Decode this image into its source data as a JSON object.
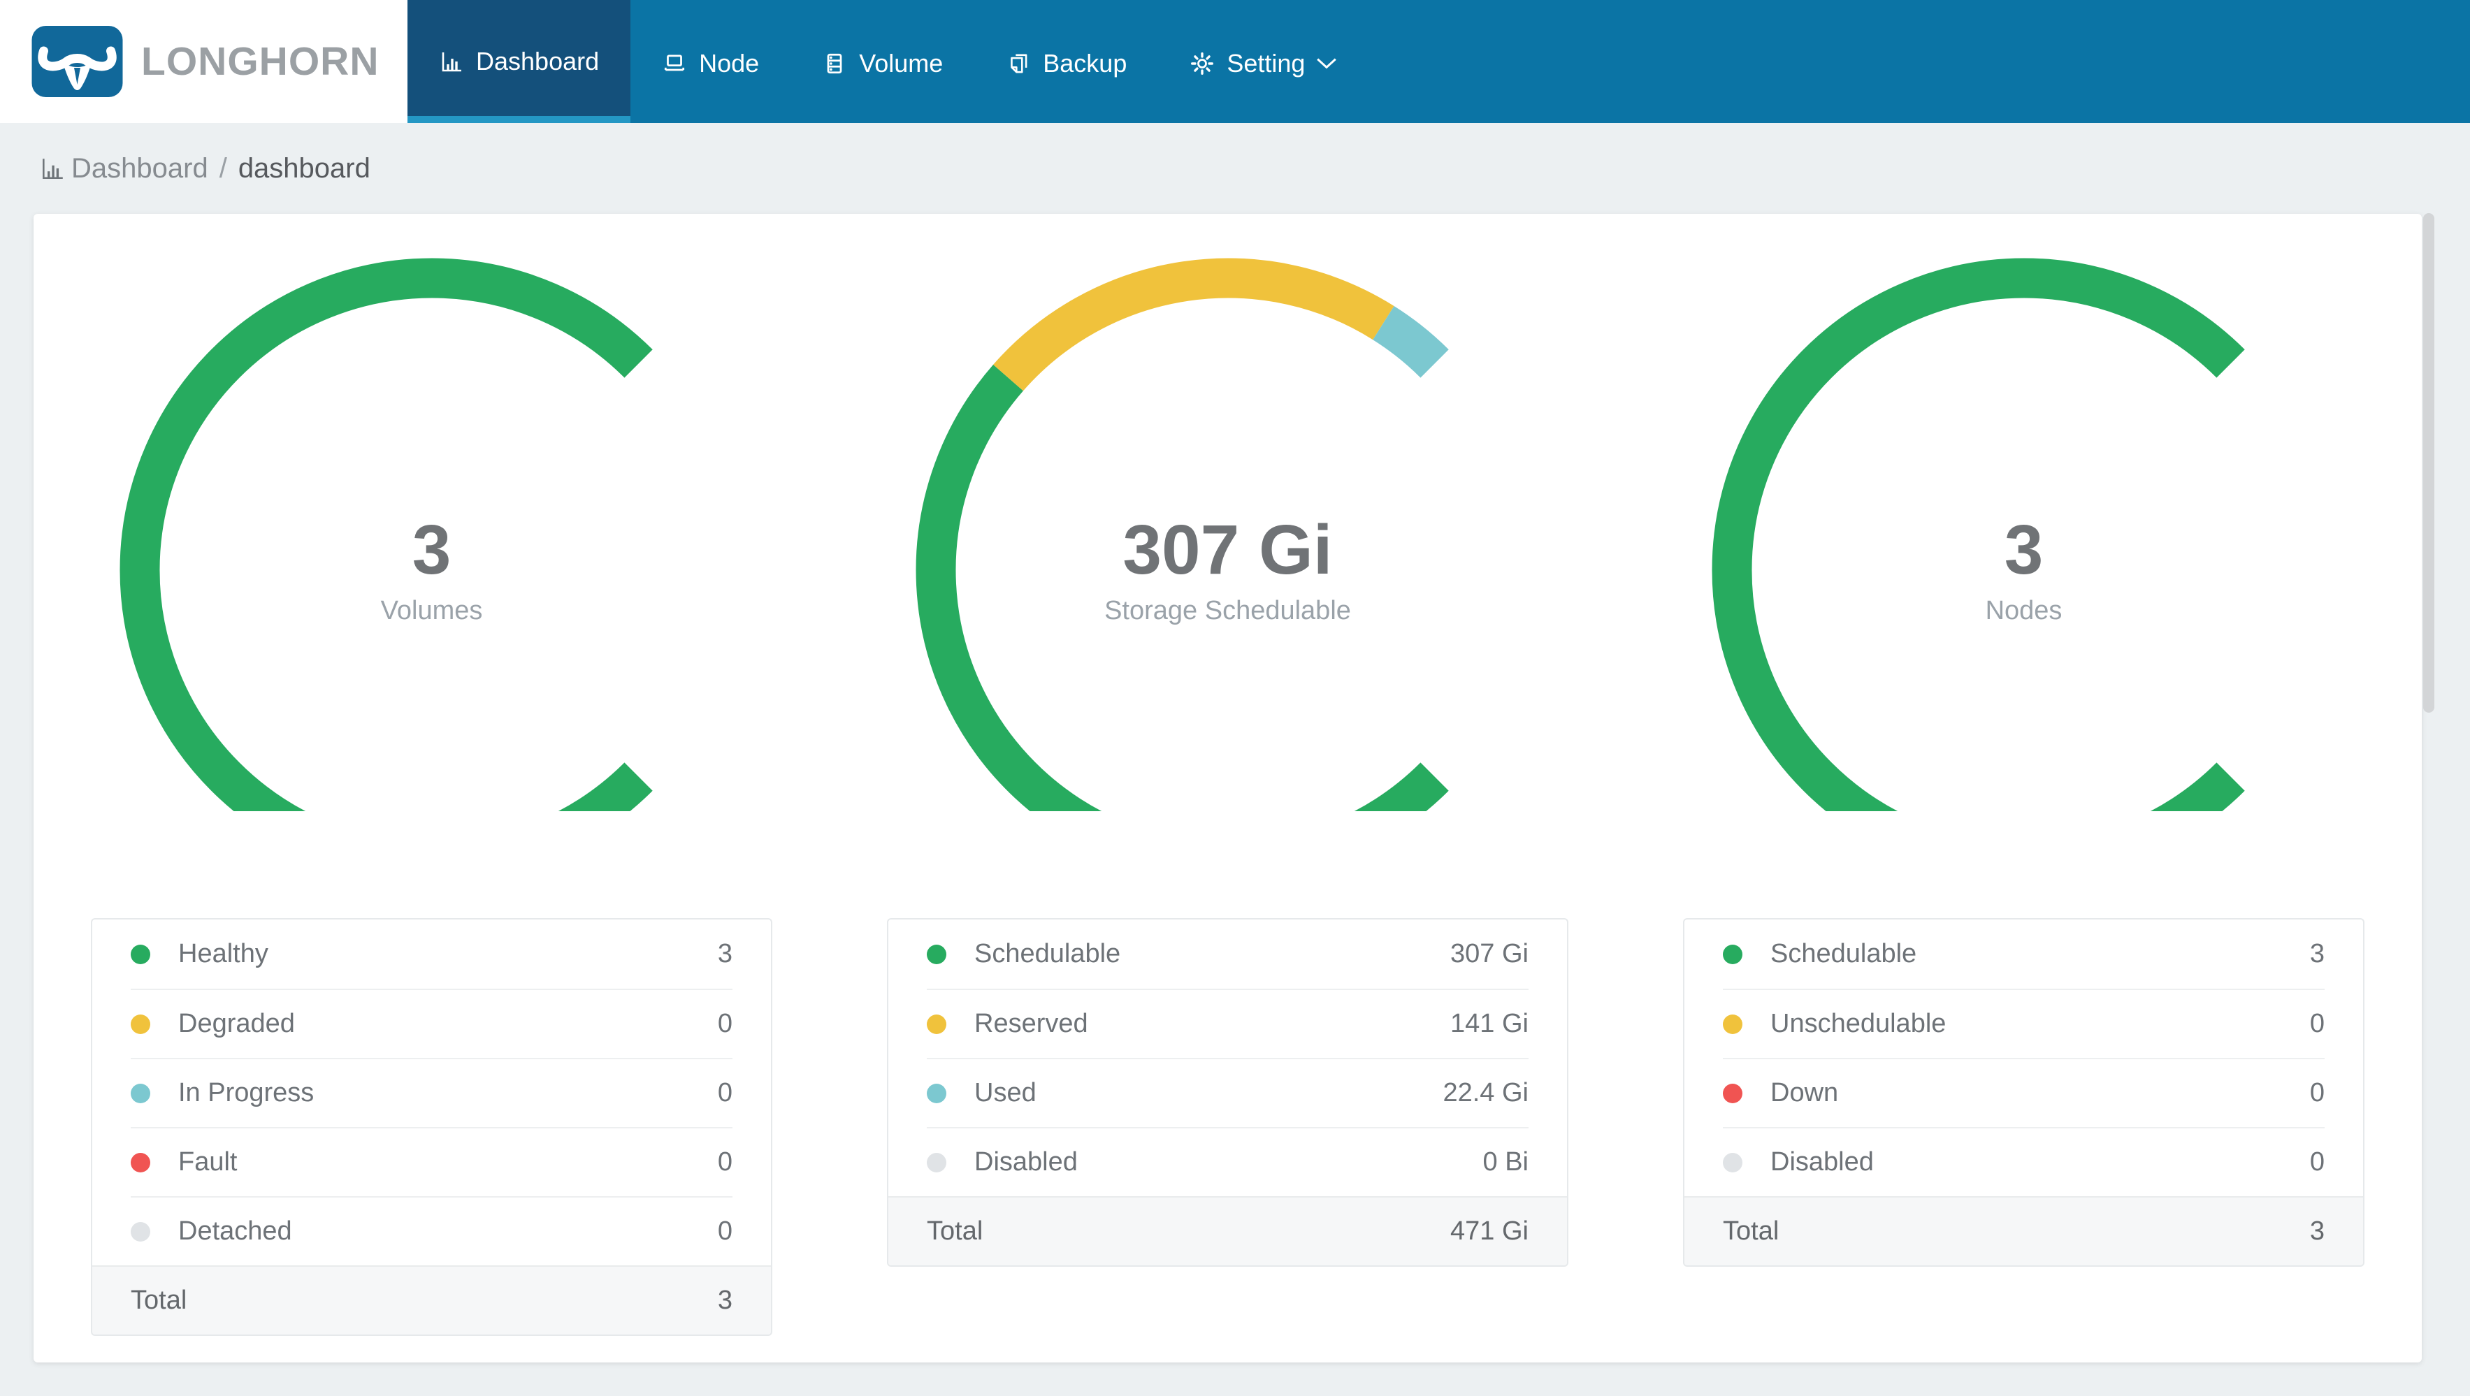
{
  "colors": {
    "nav_bg": "#0b74a5",
    "nav_active_bg": "#14507b",
    "nav_active_underline": "#2497c4",
    "page_bg": "#ecf0f2",
    "logo_bg": "#11689a",
    "brand_text": "#9ba0a4",
    "green": "#27ab5f",
    "yellow": "#f0c23c",
    "teal": "#7cc8d0",
    "red": "#f05452",
    "gray": "#e0e3e6"
  },
  "nav": {
    "brand": "LONGHORN",
    "items": [
      {
        "label": "Dashboard",
        "icon": "bar-chart-icon",
        "active": true
      },
      {
        "label": "Node",
        "icon": "laptop-icon",
        "active": false
      },
      {
        "label": "Volume",
        "icon": "database-icon",
        "active": false
      },
      {
        "label": "Backup",
        "icon": "copy-icon",
        "active": false
      },
      {
        "label": "Setting",
        "icon": "gear-icon",
        "active": false,
        "has_dropdown": true
      }
    ]
  },
  "breadcrumb": {
    "icon": "bar-chart-icon",
    "section": "Dashboard",
    "separator": "/",
    "page": "dashboard"
  },
  "chart_data": [
    {
      "type": "gauge-donut",
      "arc_degrees": 270,
      "center_value": "3",
      "center_label": "Volumes",
      "segments": [
        {
          "label": "Healthy",
          "value": 3,
          "color": "#27ab5f"
        },
        {
          "label": "Degraded",
          "value": 0,
          "color": "#f0c23c"
        },
        {
          "label": "In Progress",
          "value": 0,
          "color": "#7cc8d0"
        },
        {
          "label": "Fault",
          "value": 0,
          "color": "#f05452"
        },
        {
          "label": "Detached",
          "value": 0,
          "color": "#e0e3e6"
        }
      ],
      "total_label": "Total",
      "total_value": 3
    },
    {
      "type": "gauge-donut",
      "arc_degrees": 270,
      "center_value": "307 Gi",
      "center_label": "Storage Schedulable",
      "unit": "Gi",
      "segments": [
        {
          "label": "Schedulable",
          "value": 307,
          "color": "#27ab5f"
        },
        {
          "label": "Reserved",
          "value": 141,
          "color": "#f0c23c"
        },
        {
          "label": "Used",
          "value": 22.4,
          "color": "#7cc8d0"
        },
        {
          "label": "Disabled",
          "value": 0,
          "color": "#e0e3e6"
        }
      ],
      "total_label": "Total",
      "total_value": 471
    },
    {
      "type": "gauge-donut",
      "arc_degrees": 270,
      "center_value": "3",
      "center_label": "Nodes",
      "segments": [
        {
          "label": "Schedulable",
          "value": 3,
          "color": "#27ab5f"
        },
        {
          "label": "Unschedulable",
          "value": 0,
          "color": "#f0c23c"
        },
        {
          "label": "Down",
          "value": 0,
          "color": "#f05452"
        },
        {
          "label": "Disabled",
          "value": 0,
          "color": "#e0e3e6"
        }
      ],
      "total_label": "Total",
      "total_value": 3
    }
  ],
  "panels": [
    {
      "center_value": "3",
      "center_label": "Volumes",
      "rows": [
        {
          "label": "Healthy",
          "value": "3",
          "color": "#27ab5f"
        },
        {
          "label": "Degraded",
          "value": "0",
          "color": "#f0c23c"
        },
        {
          "label": "In Progress",
          "value": "0",
          "color": "#7cc8d0"
        },
        {
          "label": "Fault",
          "value": "0",
          "color": "#f05452"
        },
        {
          "label": "Detached",
          "value": "0",
          "color": "#e0e3e6"
        }
      ],
      "total_label": "Total",
      "total_value": "3"
    },
    {
      "center_value": "307 Gi",
      "center_label": "Storage Schedulable",
      "rows": [
        {
          "label": "Schedulable",
          "value": "307 Gi",
          "color": "#27ab5f"
        },
        {
          "label": "Reserved",
          "value": "141 Gi",
          "color": "#f0c23c"
        },
        {
          "label": "Used",
          "value": "22.4 Gi",
          "color": "#7cc8d0"
        },
        {
          "label": "Disabled",
          "value": "0 Bi",
          "color": "#e0e3e6"
        }
      ],
      "total_label": "Total",
      "total_value": "471 Gi"
    },
    {
      "center_value": "3",
      "center_label": "Nodes",
      "rows": [
        {
          "label": "Schedulable",
          "value": "3",
          "color": "#27ab5f"
        },
        {
          "label": "Unschedulable",
          "value": "0",
          "color": "#f0c23c"
        },
        {
          "label": "Down",
          "value": "0",
          "color": "#f05452"
        },
        {
          "label": "Disabled",
          "value": "0",
          "color": "#e0e3e6"
        }
      ],
      "total_label": "Total",
      "total_value": "3"
    }
  ]
}
